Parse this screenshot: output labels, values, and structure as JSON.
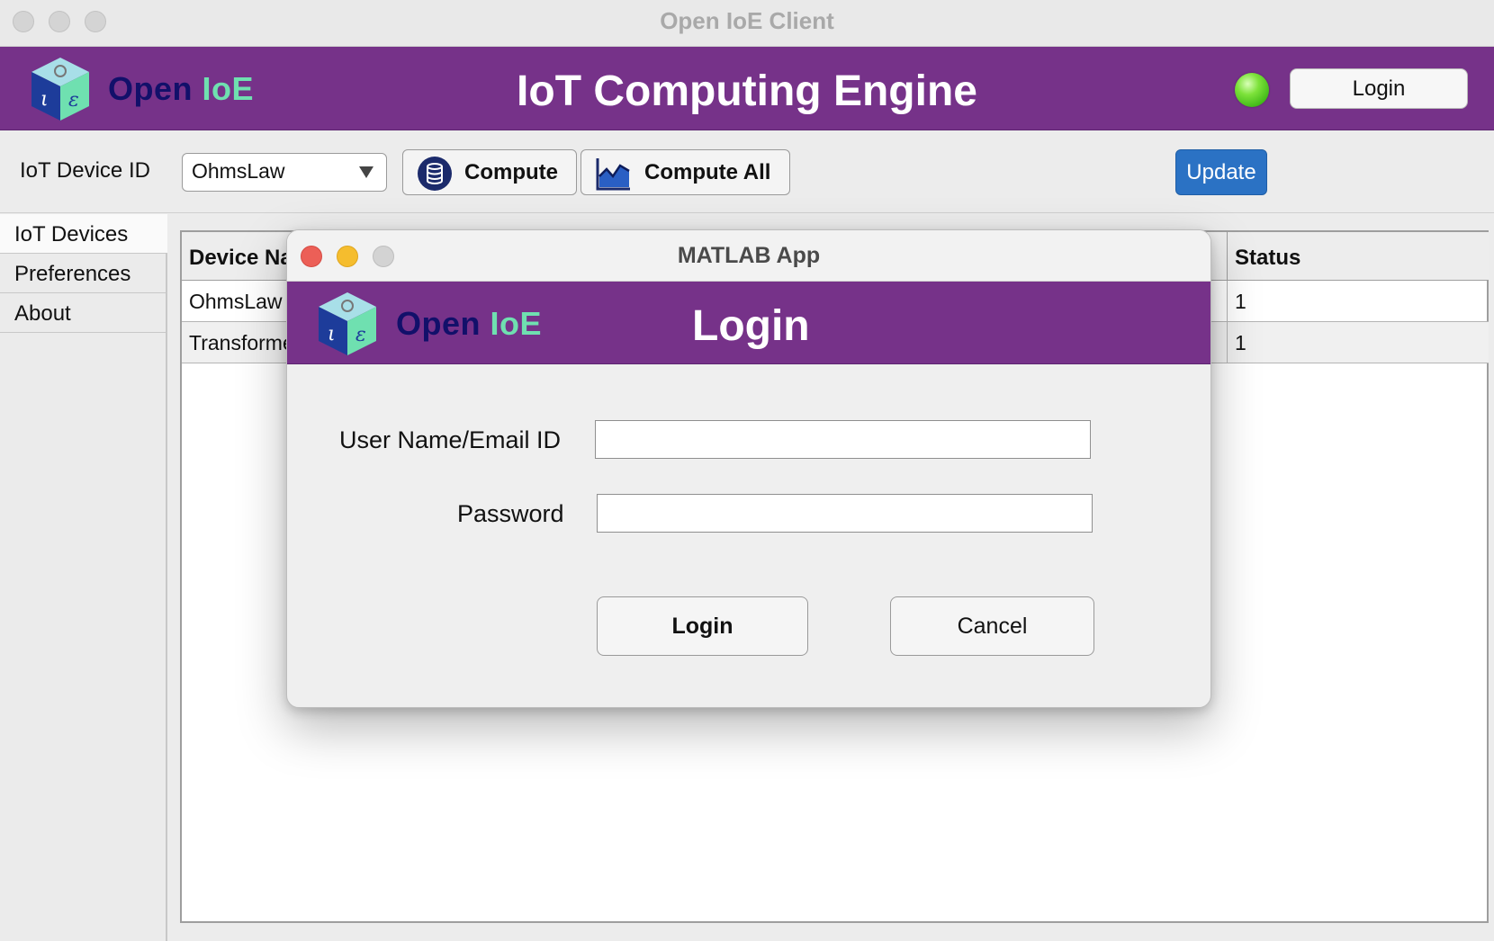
{
  "window": {
    "title": "Open IoE Client"
  },
  "brand": {
    "part1": "Open",
    "part2": "IoE"
  },
  "header": {
    "title": "IoT Computing Engine",
    "login_label": "Login",
    "status_color": "#5fd12a"
  },
  "toolbar": {
    "device_id_label": "IoT Device ID",
    "device_selected": "OhmsLaw",
    "compute_label": "Compute",
    "compute_all_label": "Compute All",
    "update_label": "Update"
  },
  "sidebar": {
    "items": [
      {
        "label": "IoT Devices"
      },
      {
        "label": "Preferences"
      },
      {
        "label": "About"
      }
    ]
  },
  "table": {
    "headers": {
      "device_name": "Device Na",
      "status": "Status"
    },
    "rows": [
      {
        "device_name": "OhmsLaw",
        "status": "1"
      },
      {
        "device_name": "Transformer",
        "status": "1"
      }
    ]
  },
  "modal": {
    "window_title": "MATLAB App",
    "brand_part1": "Open",
    "brand_part2": "IoE",
    "heading": "Login",
    "username_label": "User Name/Email ID",
    "username_value": "",
    "password_label": "Password",
    "password_value": "",
    "login_label": "Login",
    "cancel_label": "Cancel"
  },
  "colors": {
    "brand_purple": "#763289",
    "brand_navy": "#12106a",
    "brand_mint": "#6fe0b0",
    "accent_blue": "#2b72c4"
  }
}
